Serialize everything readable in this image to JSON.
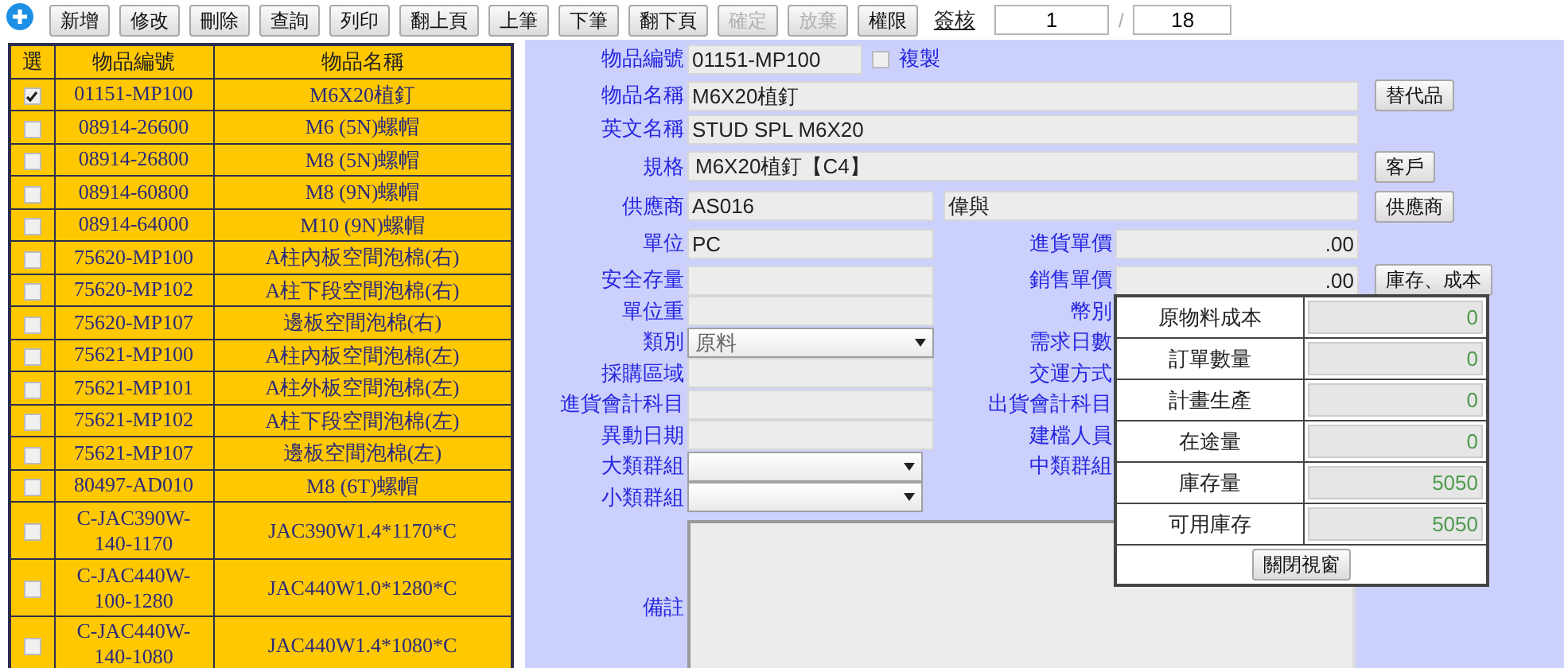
{
  "toolbar": {
    "buttons": [
      {
        "label": "新增",
        "disabled": false
      },
      {
        "label": "修改",
        "disabled": false
      },
      {
        "label": "刪除",
        "disabled": false
      },
      {
        "label": "查詢",
        "disabled": false
      },
      {
        "label": "列印",
        "disabled": false
      },
      {
        "label": "翻上頁",
        "disabled": false
      },
      {
        "label": "上筆",
        "disabled": false
      },
      {
        "label": "下筆",
        "disabled": false
      },
      {
        "label": "翻下頁",
        "disabled": false
      },
      {
        "label": "確定",
        "disabled": true
      },
      {
        "label": "放棄",
        "disabled": true
      },
      {
        "label": "權限",
        "disabled": false
      }
    ],
    "signoff_link": "簽核",
    "page": {
      "current": "1",
      "separator": "/",
      "total": "18"
    }
  },
  "item_list": {
    "columns": [
      "選",
      "物品編號",
      "物品名稱"
    ],
    "rows": [
      {
        "checked": true,
        "code": "01151-MP100",
        "name": "M6X20植釘"
      },
      {
        "checked": false,
        "code": "08914-26600",
        "name": "M6 (5N)螺帽"
      },
      {
        "checked": false,
        "code": "08914-26800",
        "name": "M8 (5N)螺帽"
      },
      {
        "checked": false,
        "code": "08914-60800",
        "name": "M8 (9N)螺帽"
      },
      {
        "checked": false,
        "code": "08914-64000",
        "name": "M10 (9N)螺帽"
      },
      {
        "checked": false,
        "code": "75620-MP100",
        "name": "A柱內板空間泡棉(右)"
      },
      {
        "checked": false,
        "code": "75620-MP102",
        "name": "A柱下段空間泡棉(右)"
      },
      {
        "checked": false,
        "code": "75620-MP107",
        "name": "邊板空間泡棉(右)"
      },
      {
        "checked": false,
        "code": "75621-MP100",
        "name": "A柱內板空間泡棉(左)"
      },
      {
        "checked": false,
        "code": "75621-MP101",
        "name": "A柱外板空間泡棉(左)"
      },
      {
        "checked": false,
        "code": "75621-MP102",
        "name": "A柱下段空間泡棉(左)"
      },
      {
        "checked": false,
        "code": "75621-MP107",
        "name": "邊板空間泡棉(左)"
      },
      {
        "checked": false,
        "code": "80497-AD010",
        "name": "M8 (6T)螺帽"
      },
      {
        "checked": false,
        "code": "C-JAC390W-140-1170",
        "name": "JAC390W1.4*1170*C"
      },
      {
        "checked": false,
        "code": "C-JAC440W-100-1280",
        "name": "JAC440W1.0*1280*C"
      },
      {
        "checked": false,
        "code": "C-JAC440W-140-1080",
        "name": "JAC440W1.4*1080*C"
      }
    ]
  },
  "form": {
    "item_code": {
      "label": "物品編號",
      "value": "01151-MP100"
    },
    "copy_option": {
      "label": "複製",
      "checked": false
    },
    "item_name": {
      "label": "物品名稱",
      "value": "M6X20植釘"
    },
    "substitute_button": "替代品",
    "english_name": {
      "label": "英文名稱",
      "value": "STUD SPL M6X20"
    },
    "spec": {
      "label": "規格",
      "value": "M6X20植釘【C4】"
    },
    "customer_button": "客戶",
    "supplier": {
      "label": "供應商",
      "code": "AS016",
      "name": "偉與"
    },
    "supplier_button": "供應商",
    "unit": {
      "label": "單位",
      "value": "PC"
    },
    "purchase_price": {
      "label": "進貨單價",
      "value": ".00"
    },
    "safety_stock": {
      "label": "安全存量"
    },
    "sale_price": {
      "label": "銷售單價",
      "value": ".00"
    },
    "stock_cost_button": "庫存、成本",
    "unit_weight": {
      "label": "單位重"
    },
    "currency": {
      "label": "幣別"
    },
    "category": {
      "label": "類別",
      "value": "原料"
    },
    "demand_days": {
      "label": "需求日數"
    },
    "purchase_region": {
      "label": "採購區域"
    },
    "shipping_method": {
      "label": "交運方式"
    },
    "purchase_account": {
      "label": "進貨會計科目"
    },
    "shipping_account": {
      "label": "出貨會計科目"
    },
    "change_date": {
      "label": "異動日期"
    },
    "created_by": {
      "label": "建檔人員"
    },
    "major_group": {
      "label": "大類群組"
    },
    "mid_group": {
      "label": "中類群組"
    },
    "minor_group": {
      "label": "小類群組"
    },
    "remarks": {
      "label": "備註"
    }
  },
  "stock_popup": {
    "rows": [
      {
        "label": "原物料成本",
        "value": "0"
      },
      {
        "label": "訂單數量",
        "value": "0"
      },
      {
        "label": "計畫生產",
        "value": "0"
      },
      {
        "label": "在途量",
        "value": "0"
      },
      {
        "label": "庫存量",
        "value": "5050"
      },
      {
        "label": "可用庫存",
        "value": "5050"
      }
    ],
    "close_button": "關閉視窗"
  }
}
